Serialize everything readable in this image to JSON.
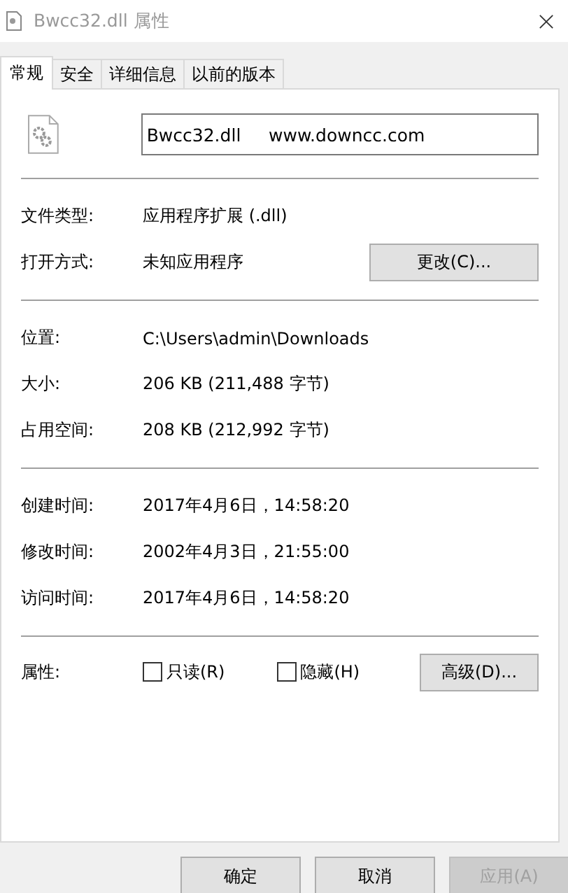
{
  "window": {
    "title": "Bwcc32.dll 属性"
  },
  "tabs": [
    {
      "label": "常规",
      "selected": true
    },
    {
      "label": "安全",
      "selected": false
    },
    {
      "label": "详细信息",
      "selected": false
    },
    {
      "label": "以前的版本",
      "selected": false
    }
  ],
  "file_name": {
    "value": "Bwcc32.dll     www.downcc.com"
  },
  "sections": [
    [
      {
        "label": "文件类型:",
        "value": "应用程序扩展 (.dll)"
      },
      {
        "label": "打开方式:",
        "value": "未知应用程序",
        "button": "更改(C)..."
      }
    ],
    [
      {
        "label": "位置:",
        "value": "C:\\Users\\admin\\Downloads"
      },
      {
        "label": "大小:",
        "value": "206 KB (211,488 字节)"
      },
      {
        "label": "占用空间:",
        "value": "208 KB (212,992 字节)"
      }
    ],
    [
      {
        "label": "创建时间:",
        "value": "2017年4月6日，14:58:20"
      },
      {
        "label": "修改时间:",
        "value": "2002年4月3日，21:55:00"
      },
      {
        "label": "访问时间:",
        "value": "2017年4月6日，14:58:20"
      }
    ]
  ],
  "attributes": {
    "label": "属性:",
    "options": [
      {
        "label": "只读(R)",
        "checked": false
      },
      {
        "label": "隐藏(H)",
        "checked": false
      }
    ],
    "button": "高级(D)..."
  },
  "buttons": [
    {
      "label": "确定",
      "disabled": false
    },
    {
      "label": "取消",
      "disabled": false
    },
    {
      "label": "应用(A)",
      "disabled": true
    }
  ]
}
